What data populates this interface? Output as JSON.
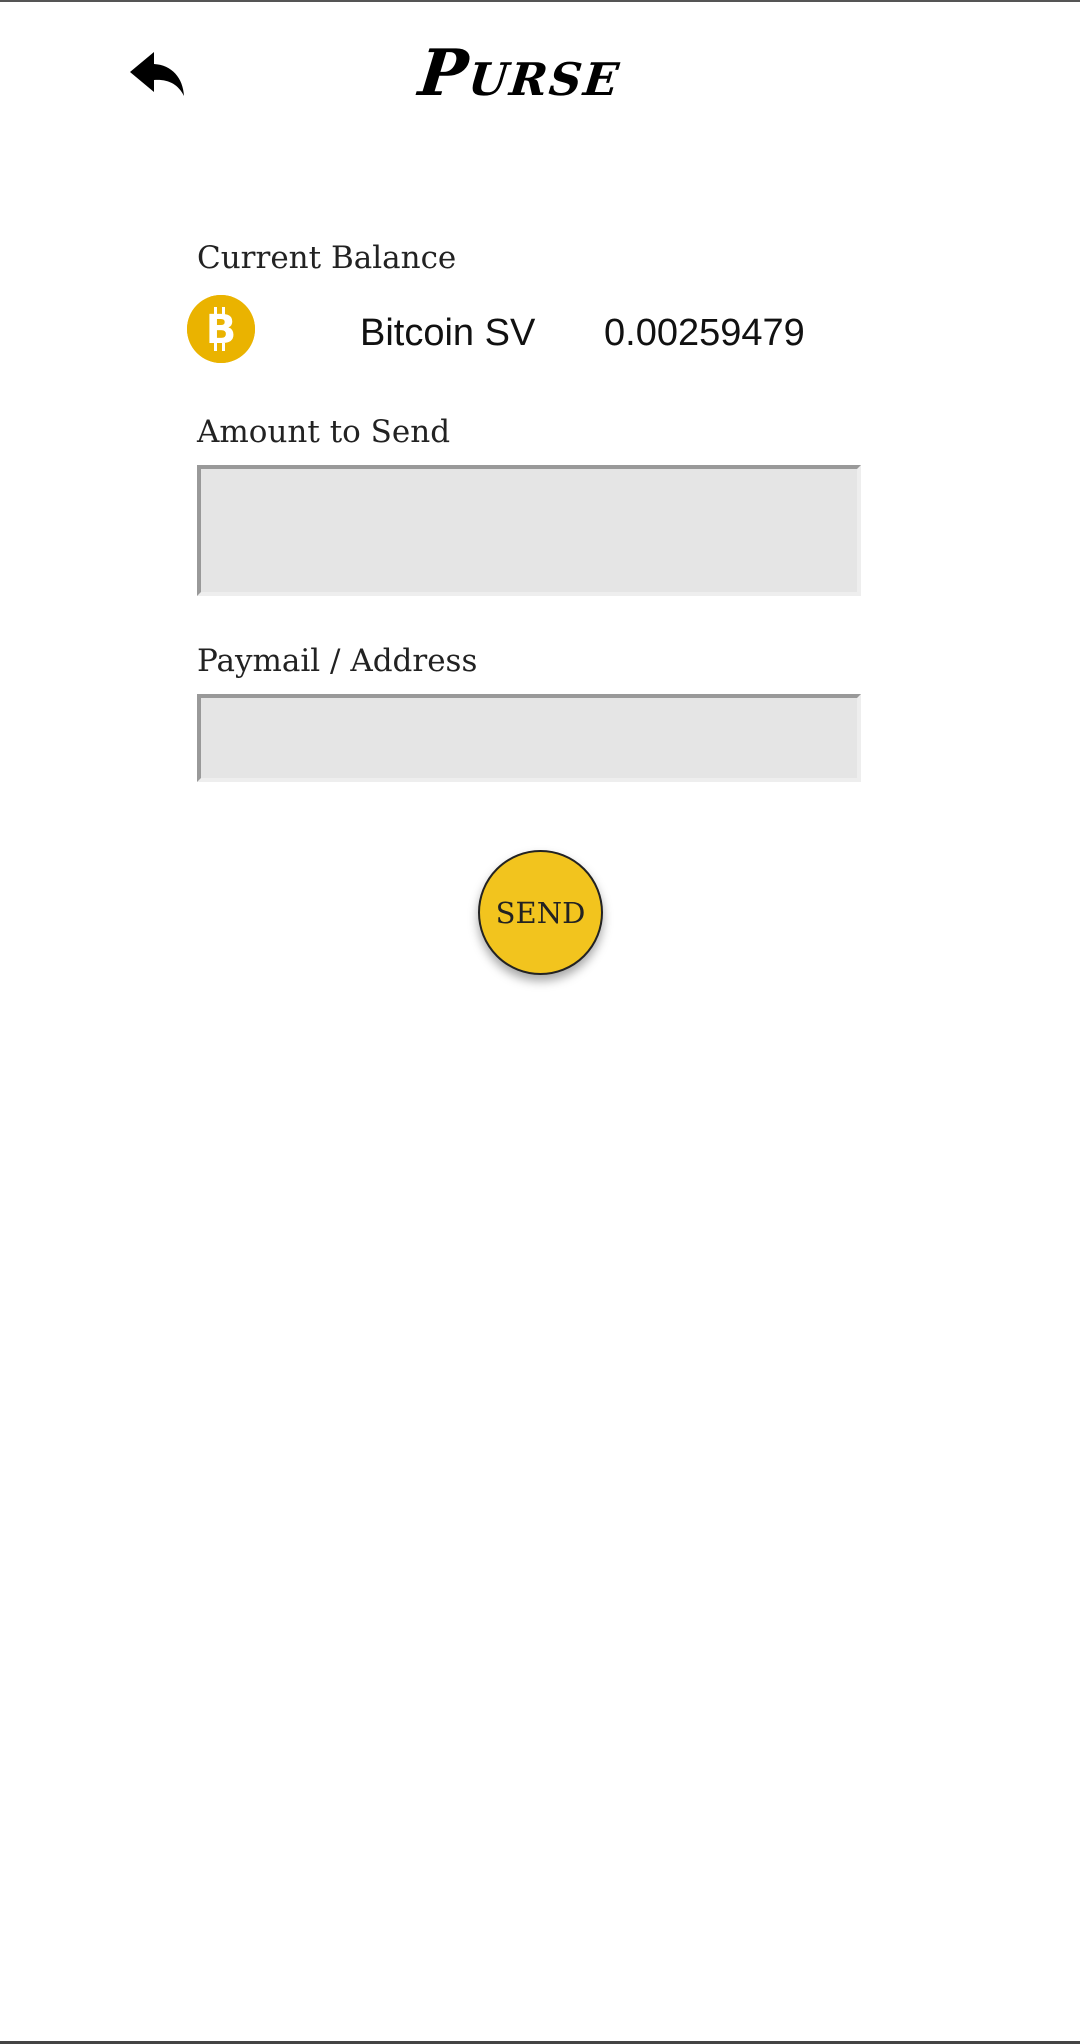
{
  "header": {
    "back_icon": "reply-arrow-icon",
    "title": "Purse"
  },
  "balance": {
    "label": "Current Balance",
    "coin_icon": "bitcoin-icon",
    "currency": "Bitcoin SV",
    "amount": "0.00259479"
  },
  "amount_field": {
    "label": "Amount to Send",
    "value": "",
    "placeholder": ""
  },
  "address_field": {
    "label": "Paymail / Address",
    "value": "",
    "placeholder": ""
  },
  "send_button": {
    "label": "SEND"
  },
  "colors": {
    "coin": "#eab300",
    "send_button": "#f2c41e",
    "field_background": "#e5e5e5"
  }
}
